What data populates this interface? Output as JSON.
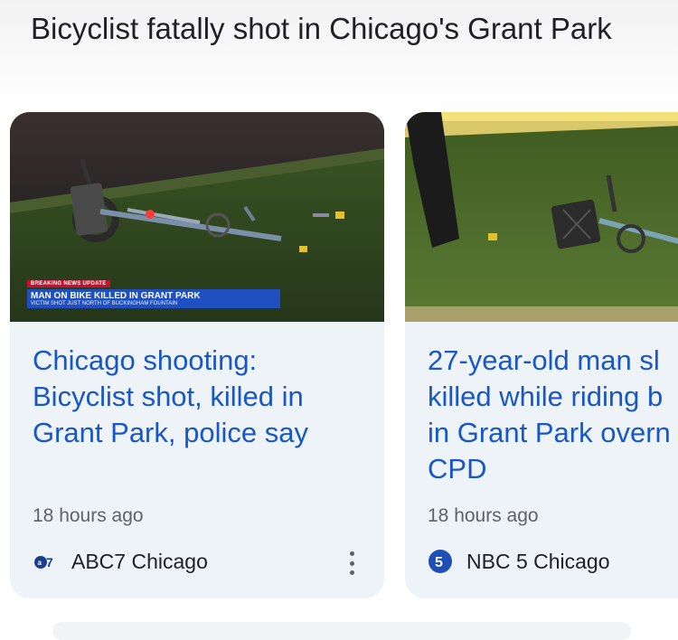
{
  "heading": "Bicyclist fatally shot in Chicago's Grant Park",
  "cards": [
    {
      "title_lines": [
        "Chicago shooting:",
        "Bicyclist shot, killed in",
        "Grant Park, police say"
      ],
      "time": "18 hours ago",
      "source": "ABC7 Chicago",
      "source_icon": "abc7-logo-icon",
      "banner": {
        "tag": "BREAKING NEWS UPDATE",
        "headline": "MAN ON BIKE KILLED IN GRANT PARK",
        "sub": "VICTIM SHOT JUST NORTH OF BUCKINGHAM FOUNTAIN"
      }
    },
    {
      "title_lines": [
        "27-year-old man sl",
        "killed while riding b",
        "in Grant Park overn",
        "CPD"
      ],
      "time": "18 hours ago",
      "source": "NBC 5 Chicago",
      "source_icon": "nbc5-logo-icon"
    }
  ],
  "colors": {
    "title_link": "#1a57c6",
    "card_bg": "#eef3f8",
    "meta_text": "#5f6368"
  }
}
